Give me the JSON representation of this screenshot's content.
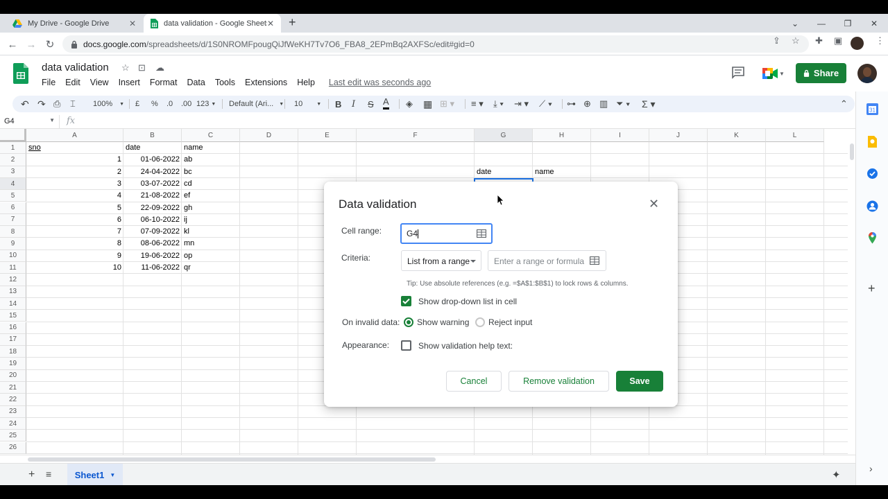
{
  "browser": {
    "tabs": [
      {
        "title": "My Drive - Google Drive",
        "close": "✕"
      },
      {
        "title": "data validation - Google Sheets",
        "close": "✕"
      }
    ],
    "new_tab": "+",
    "url_host": "docs.google.com",
    "url_path": "/spreadsheets/d/1S0NROMFpougQiJfWeKH7Tv7O6_FBA8_2EPmBq2AXFSc/edit#gid=0"
  },
  "doc": {
    "title": "data validation",
    "menus": [
      "File",
      "Edit",
      "View",
      "Insert",
      "Format",
      "Data",
      "Tools",
      "Extensions",
      "Help"
    ],
    "last_edit": "Last edit was seconds ago",
    "share_label": "Share"
  },
  "toolbar": {
    "zoom": "100%",
    "currency": "£",
    "percent": "%",
    "dec_less": ".0",
    "dec_more": ".00",
    "more_formats": "123",
    "font": "Default (Ari...",
    "font_size": "10"
  },
  "formula_bar": {
    "name_box": "G4",
    "fx": "fx"
  },
  "grid": {
    "columns": [
      "A",
      "B",
      "C",
      "D",
      "E",
      "F",
      "G",
      "H",
      "I",
      "J",
      "K",
      "L"
    ],
    "rows": [
      "1",
      "2",
      "3",
      "4",
      "5",
      "6",
      "7",
      "8",
      "9",
      "10",
      "11",
      "12",
      "13",
      "14",
      "15",
      "16",
      "17",
      "18",
      "19",
      "20",
      "21",
      "22",
      "23",
      "24",
      "25",
      "26"
    ],
    "headers": {
      "sno": "sno",
      "date": "date",
      "name": "name"
    },
    "data": [
      {
        "sno": "1",
        "date": "01-06-2022",
        "name": "ab"
      },
      {
        "sno": "2",
        "date": "24-04-2022",
        "name": "bc"
      },
      {
        "sno": "3",
        "date": "03-07-2022",
        "name": "cd"
      },
      {
        "sno": "4",
        "date": "21-08-2022",
        "name": "ef"
      },
      {
        "sno": "5",
        "date": "22-09-2022",
        "name": "gh"
      },
      {
        "sno": "6",
        "date": "06-10-2022",
        "name": "ij"
      },
      {
        "sno": "7",
        "date": "07-09-2022",
        "name": "kl"
      },
      {
        "sno": "8",
        "date": "08-06-2022",
        "name": "mn"
      },
      {
        "sno": "9",
        "date": "19-06-2022",
        "name": "op"
      },
      {
        "sno": "10",
        "date": "11-06-2022",
        "name": "qr"
      }
    ],
    "g3": "date",
    "h3": "name"
  },
  "sheet_tab": "Sheet1",
  "dialog": {
    "title": "Data validation",
    "cell_range_label": "Cell range:",
    "cell_range_value": "G4",
    "criteria_label": "Criteria:",
    "criteria_value": "List from a range",
    "formula_placeholder": "Enter a range or formula",
    "tip": "Tip: Use absolute references (e.g. =$A$1:$B$1) to lock rows & columns.",
    "show_dropdown_label": "Show drop-down list in cell",
    "show_dropdown_checked": true,
    "invalid_label": "On invalid data:",
    "show_warning": "Show warning",
    "reject_input": "Reject input",
    "appearance_label": "Appearance:",
    "help_text_label": "Show validation help text:",
    "help_text_checked": false,
    "cancel": "Cancel",
    "remove": "Remove validation",
    "save": "Save"
  },
  "colors": {
    "accent_green": "#188038",
    "selection_blue": "#1a73e8"
  }
}
